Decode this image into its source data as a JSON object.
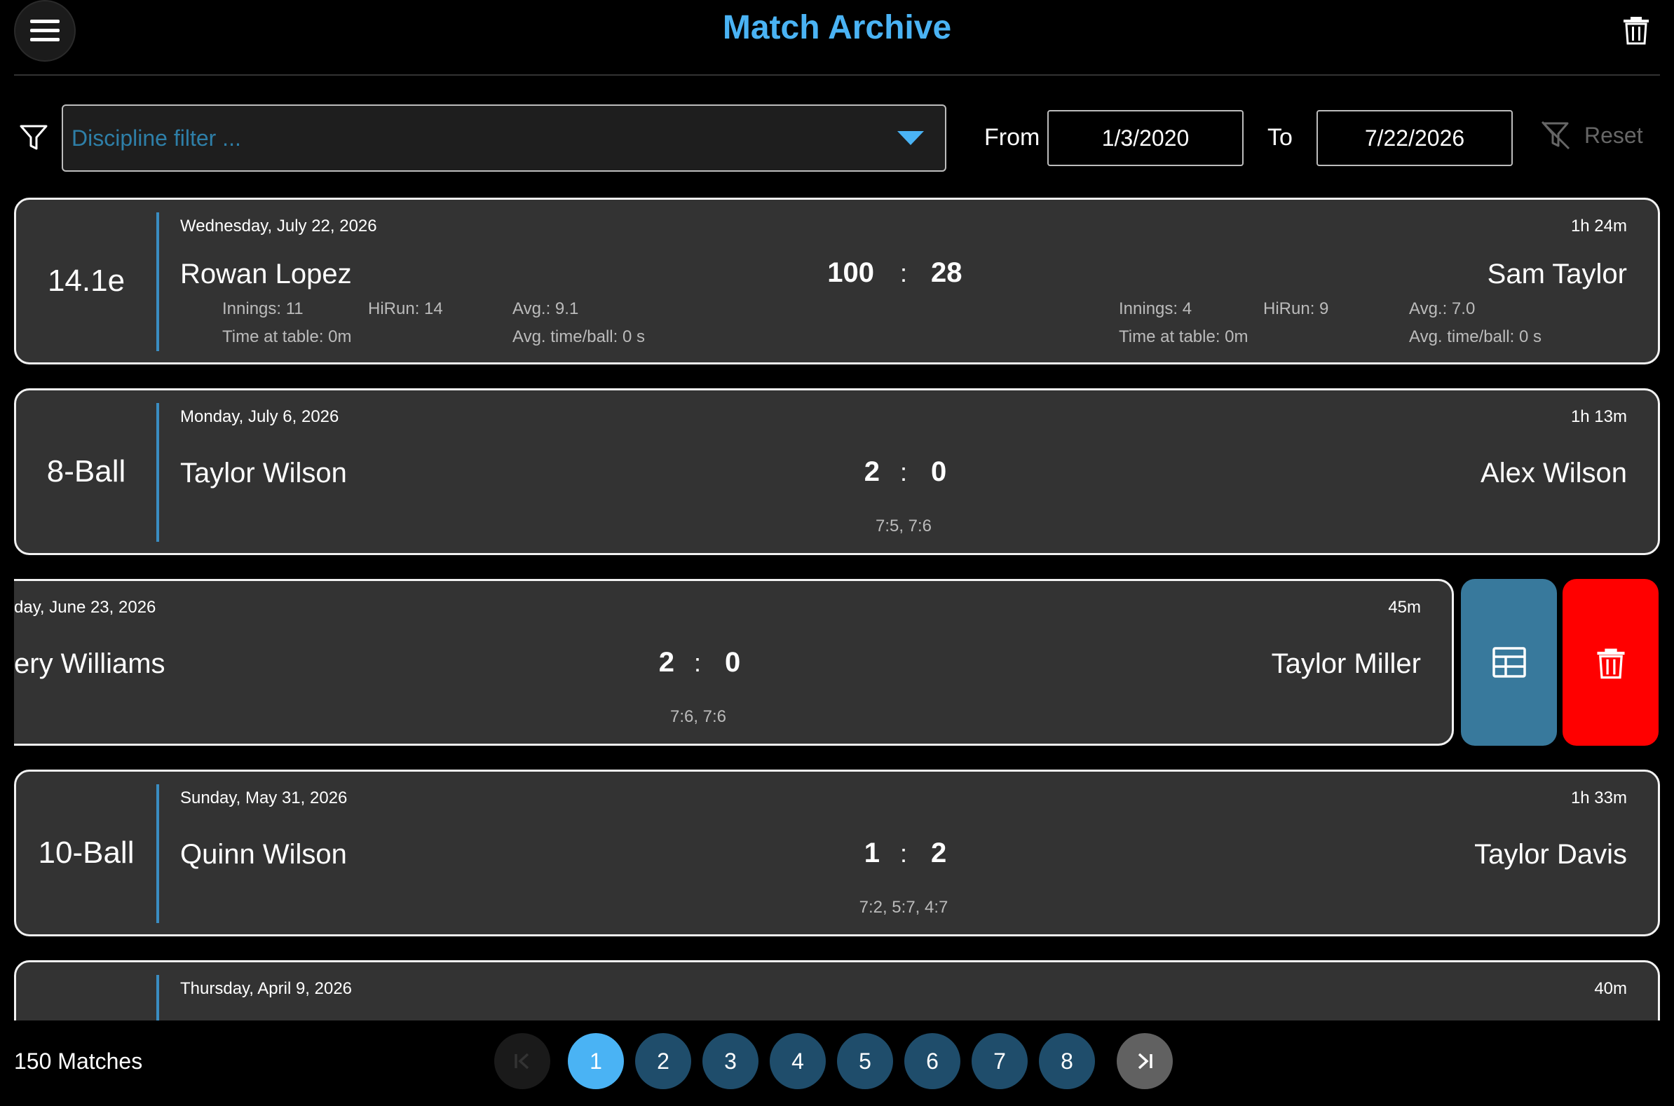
{
  "header": {
    "title": "Match Archive",
    "menu_icon": "hamburger-menu-icon",
    "delete_all_icon": "trash-icon"
  },
  "filter": {
    "filter_icon": "funnel-icon",
    "discipline_placeholder": "Discipline filter ...",
    "from_label": "From",
    "from_value": "1/3/2020",
    "to_label": "To",
    "to_value": "7/22/2026",
    "reset_label": "Reset"
  },
  "matches": [
    {
      "discipline": "14.1e",
      "date": "Wednesday, July 22, 2026",
      "duration": "1h 24m",
      "player1": "Rowan Lopez",
      "player2": "Sam Taylor",
      "score1": "100",
      "score2": "28",
      "sep": ":",
      "p1_innings": "Innings: 11",
      "p1_hirun": "HiRun: 14",
      "p1_avg": "Avg.: 9.1",
      "p1_time": "Time at table: 0m",
      "p1_avgtime": "Avg. time/ball: 0 s",
      "p2_innings": "Innings: 4",
      "p2_hirun": "HiRun: 9",
      "p2_avg": "Avg.: 7.0",
      "p2_time": "Time at table: 0m",
      "p2_avgtime": "Avg. time/ball: 0 s"
    },
    {
      "discipline": "8-Ball",
      "date": "Monday, July 6, 2026",
      "duration": "1h 13m",
      "player1": "Taylor Wilson",
      "player2": "Alex Wilson",
      "score1": "2",
      "score2": "0",
      "sep": ":",
      "sets": "7:5, 7:6"
    },
    {
      "date": "day, June 23, 2026",
      "duration": "45m",
      "player1": "ery Williams",
      "player2": "Taylor Miller",
      "score1": "2",
      "score2": "0",
      "sep": ":",
      "sets": "7:6, 7:6"
    },
    {
      "discipline": "10-Ball",
      "date": "Sunday, May 31, 2026",
      "duration": "1h 33m",
      "player1": "Quinn Wilson",
      "player2": "Taylor Davis",
      "score1": "1",
      "score2": "2",
      "sep": ":",
      "sets": "7:2, 5:7, 4:7"
    },
    {
      "date": "Thursday, April 9, 2026",
      "duration": "40m"
    }
  ],
  "swipe_actions": {
    "details_icon": "table-icon",
    "delete_icon": "trash-icon",
    "details_color": "#38799c",
    "delete_color": "#ff0000"
  },
  "footer": {
    "count": "150 Matches",
    "pages": [
      "1",
      "2",
      "3",
      "4",
      "5",
      "6",
      "7",
      "8"
    ],
    "current_page": "1",
    "first_icon": "first-page-icon",
    "last_icon": "last-page-icon"
  },
  "colors": {
    "accent": "#4ab3f4",
    "background": "#000000",
    "card": "#333333",
    "divider": "#3a8dc2"
  }
}
